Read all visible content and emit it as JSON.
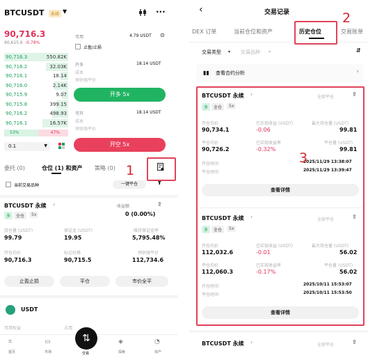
{
  "left": {
    "symbol": "BTCUSDT",
    "symbol_tag": "永续",
    "price": "90,716.3",
    "price_sub": "90,615.6",
    "change": "-0.78%",
    "orderbook": {
      "asks": [
        {
          "p": "90,716.3",
          "q": "550.82K"
        },
        {
          "p": "90,716.2",
          "q": "32.03K"
        },
        {
          "p": "90,716.1",
          "q": "18.14"
        },
        {
          "p": "90,716.0",
          "q": "2.14K"
        },
        {
          "p": "90,715.9",
          "q": "9.07"
        },
        {
          "p": "90,715.8",
          "q": "399.15"
        },
        {
          "p": "90,716.2",
          "q": "498.93"
        },
        {
          "p": "90,716.1",
          "q": "16.57K"
        }
      ],
      "buy_pct": "53%",
      "sell_pct": "47%",
      "precision": "0.1"
    },
    "form": {
      "avail_label": "可用",
      "avail_value": "4.79 USDT",
      "tpsl_label": "止盈/止损",
      "long_label": "开多",
      "long_amount": "18.14 USDT",
      "cost_label": "成本",
      "liq_label": "预估强平价",
      "long_button": "开多 5x",
      "short_label": "可开",
      "short_amount": "18.14 USDT",
      "short_cost_label": "成本",
      "short_liq_label": "预估强平价",
      "short_button": "开空 5x"
    },
    "tabs": [
      "委托 (0)",
      "仓位 (1) 和资产",
      "策略 (0)"
    ],
    "filter_label": "当前交易品种",
    "close_all": "一键平仓",
    "position": {
      "title": "BTCUSDT 永续",
      "tag_side": "多",
      "tag_margin": "全仓",
      "tag_lev": "5x",
      "pnl_label": "收益额",
      "pnl_value": "0",
      "pnl_pct": "0 (0.00%)",
      "fields": [
        {
          "label": "持仓量 (USDT)",
          "value": "99.79"
        },
        {
          "label": "保证金 (USDT)",
          "value": "19.95"
        },
        {
          "label": "维持保证金率",
          "value": "5,795.48%"
        },
        {
          "label": "开仓均价",
          "value": "90,716.3"
        },
        {
          "label": "标记价格",
          "value": "90,715.5"
        },
        {
          "label": "预估强平价",
          "value": "112,734.6"
        }
      ],
      "buttons": [
        "止盈止损",
        "平仓",
        "市价全平"
      ]
    },
    "asset": {
      "name": "USDT",
      "col1": "可用权益",
      "col2": "占用"
    },
    "nav": [
      "首页",
      "市场",
      "交易",
      "探索",
      "资产"
    ]
  },
  "right": {
    "title": "交易记录",
    "tabs": [
      "DEX 订单",
      "当前仓位和资产",
      "历史仓位",
      "交易账单"
    ],
    "filters": [
      "交易类型",
      "交易品种"
    ],
    "analysis": "查看合约分析",
    "cards": [
      {
        "title": "BTCUSDT 永续",
        "status": "全部平仓",
        "tags": [
          "多",
          "全仓",
          "5x"
        ],
        "open_label": "开仓均价",
        "open": "90,734.1",
        "pnl_label": "已实现收益 (USDT)",
        "pnl": "-0.06",
        "max_label": "最大持仓量 (USDT)",
        "max": "99.81",
        "close_label": "平仓均价",
        "close": "90,726.2",
        "rate_label": "已实现收益率",
        "rate": "-0.32%",
        "closeqty_label": "平仓量 (USDT)",
        "closeqty": "99.81",
        "opentime_label": "开仓时间",
        "opentime": "2025/11/29 13:38:07",
        "closetime_label": "平仓时间",
        "closetime": "2025/11/29 13:39:47",
        "detail": "查看详情"
      },
      {
        "title": "BTCUSDT 永续",
        "status": "全部平仓",
        "tags": [
          "多",
          "全仓",
          "5x"
        ],
        "open_label": "开仓均价",
        "open": "112,032.6",
        "pnl_label": "已实现收益 (USDT)",
        "pnl": "-0.01",
        "max_label": "最大持仓量 (USDT)",
        "max": "56.02",
        "close_label": "平仓均价",
        "close": "112,060.3",
        "rate_label": "已实现收益率",
        "rate": "-0.17%",
        "closeqty_label": "平仓量 (USDT)",
        "closeqty": "56.02",
        "opentime_label": "开仓时间",
        "opentime": "2025/10/11 15:53:07",
        "closetime_label": "平仓时间",
        "closetime": "2025/10/11 15:53:50",
        "detail": "查看详情"
      }
    ],
    "bottom_card": {
      "title": "BTCUSDT 永续",
      "status": "全部平仓"
    }
  },
  "annotations": [
    "1",
    "2",
    "3"
  ]
}
